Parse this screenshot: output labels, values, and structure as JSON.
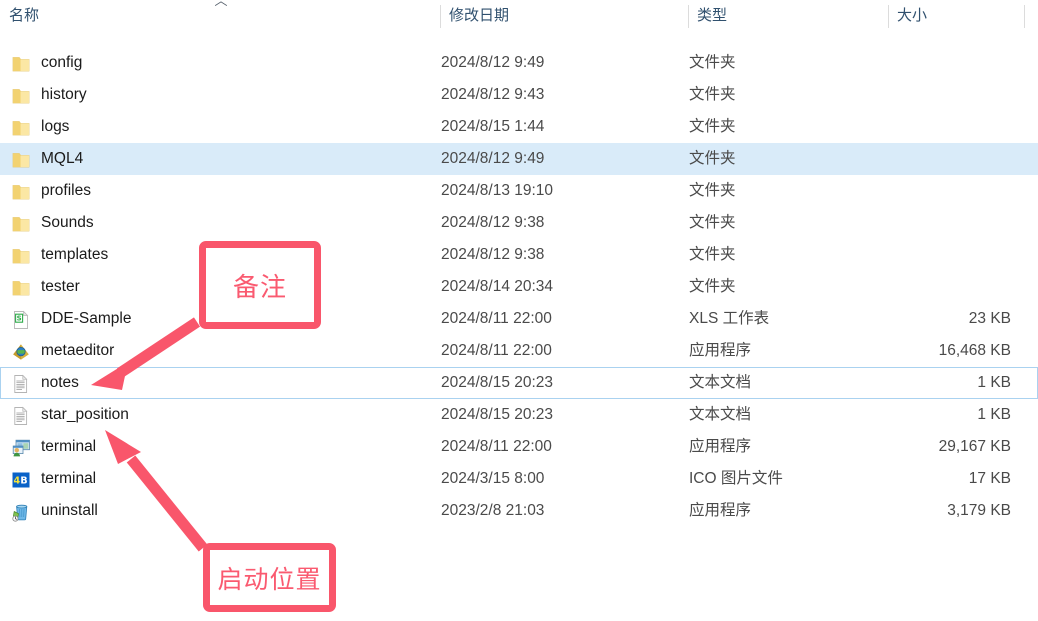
{
  "window": {
    "app": "file-explorer"
  },
  "columns": {
    "name": "名称",
    "date": "修改日期",
    "type": "类型",
    "size": "大小",
    "sort_caret": "︿"
  },
  "colors": {
    "selection": "#d9ebf9",
    "focus_border": "#aad2f0",
    "annotation": "#f9566b",
    "header_text": "#30506e",
    "folder": "#fbe08a"
  },
  "files": [
    {
      "name": "config",
      "date": "2024/8/12 9:49",
      "type": "文件夹",
      "size": "",
      "icon": "folder-icon",
      "state": "normal"
    },
    {
      "name": "history",
      "date": "2024/8/12 9:43",
      "type": "文件夹",
      "size": "",
      "icon": "folder-icon",
      "state": "normal"
    },
    {
      "name": "logs",
      "date": "2024/8/15 1:44",
      "type": "文件夹",
      "size": "",
      "icon": "folder-icon",
      "state": "normal"
    },
    {
      "name": "MQL4",
      "date": "2024/8/12 9:49",
      "type": "文件夹",
      "size": "",
      "icon": "folder-icon",
      "state": "selected"
    },
    {
      "name": "profiles",
      "date": "2024/8/13 19:10",
      "type": "文件夹",
      "size": "",
      "icon": "folder-icon",
      "state": "normal"
    },
    {
      "name": "Sounds",
      "date": "2024/8/12 9:38",
      "type": "文件夹",
      "size": "",
      "icon": "folder-icon",
      "state": "normal"
    },
    {
      "name": "templates",
      "date": "2024/8/12 9:38",
      "type": "文件夹",
      "size": "",
      "icon": "folder-icon",
      "state": "normal"
    },
    {
      "name": "tester",
      "date": "2024/8/14 20:34",
      "type": "文件夹",
      "size": "",
      "icon": "folder-icon",
      "state": "normal"
    },
    {
      "name": "DDE-Sample",
      "date": "2024/8/11 22:00",
      "type": "XLS 工作表",
      "size": "23 KB",
      "icon": "spreadsheet-icon",
      "state": "normal"
    },
    {
      "name": "metaeditor",
      "date": "2024/8/11 22:00",
      "type": "应用程序",
      "size": "16,468 KB",
      "icon": "metaeditor-icon",
      "state": "normal"
    },
    {
      "name": "notes",
      "date": "2024/8/15 20:23",
      "type": "文本文档",
      "size": "1 KB",
      "icon": "text-file-icon",
      "state": "focused"
    },
    {
      "name": "star_position",
      "date": "2024/8/15 20:23",
      "type": "文本文档",
      "size": "1 KB",
      "icon": "text-file-icon",
      "state": "normal"
    },
    {
      "name": "terminal",
      "date": "2024/8/11 22:00",
      "type": "应用程序",
      "size": "29,167 KB",
      "icon": "terminal-app-icon",
      "state": "normal"
    },
    {
      "name": "terminal",
      "date": "2024/3/15 8:00",
      "type": "ICO 图片文件",
      "size": "17 KB",
      "icon": "ico-4b-icon",
      "state": "normal"
    },
    {
      "name": "uninstall",
      "date": "2023/2/8 21:03",
      "type": "应用程序",
      "size": "3,179 KB",
      "icon": "uninstall-icon",
      "state": "normal"
    }
  ],
  "annotations": [
    {
      "text": "备注",
      "points_to": "notes"
    },
    {
      "text": "启动位置",
      "points_to": "terminal"
    }
  ]
}
